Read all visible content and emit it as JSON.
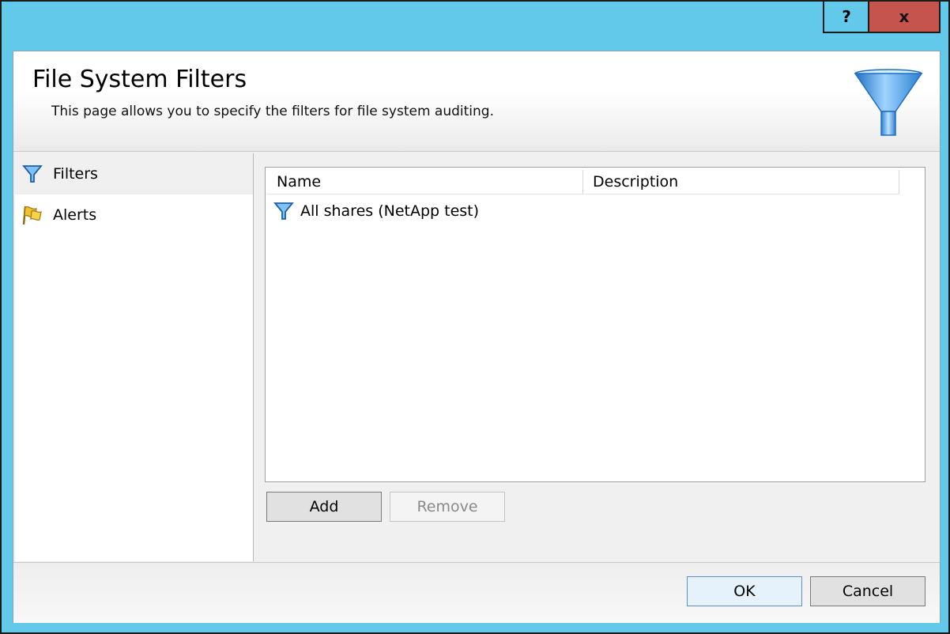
{
  "window": {
    "help_label": "?",
    "close_label": "x"
  },
  "header": {
    "title": "File System Filters",
    "subtitle": "This page allows you to specify the filters for file system auditing.",
    "icon": "funnel-icon"
  },
  "sidebar": {
    "items": [
      {
        "label": "Filters",
        "icon": "funnel-icon",
        "selected": true
      },
      {
        "label": "Alerts",
        "icon": "flag-icon",
        "selected": false
      }
    ]
  },
  "list": {
    "columns": [
      "Name",
      "Description"
    ],
    "rows": [
      {
        "name": "All shares (NetApp test)",
        "description": "",
        "icon": "funnel-icon"
      }
    ]
  },
  "buttons": {
    "add": "Add",
    "remove": "Remove",
    "ok": "OK",
    "cancel": "Cancel"
  },
  "colors": {
    "titlebar": "#62c9eb",
    "close_button": "#c4544c",
    "accent_funnel": "#3a8fd8"
  }
}
